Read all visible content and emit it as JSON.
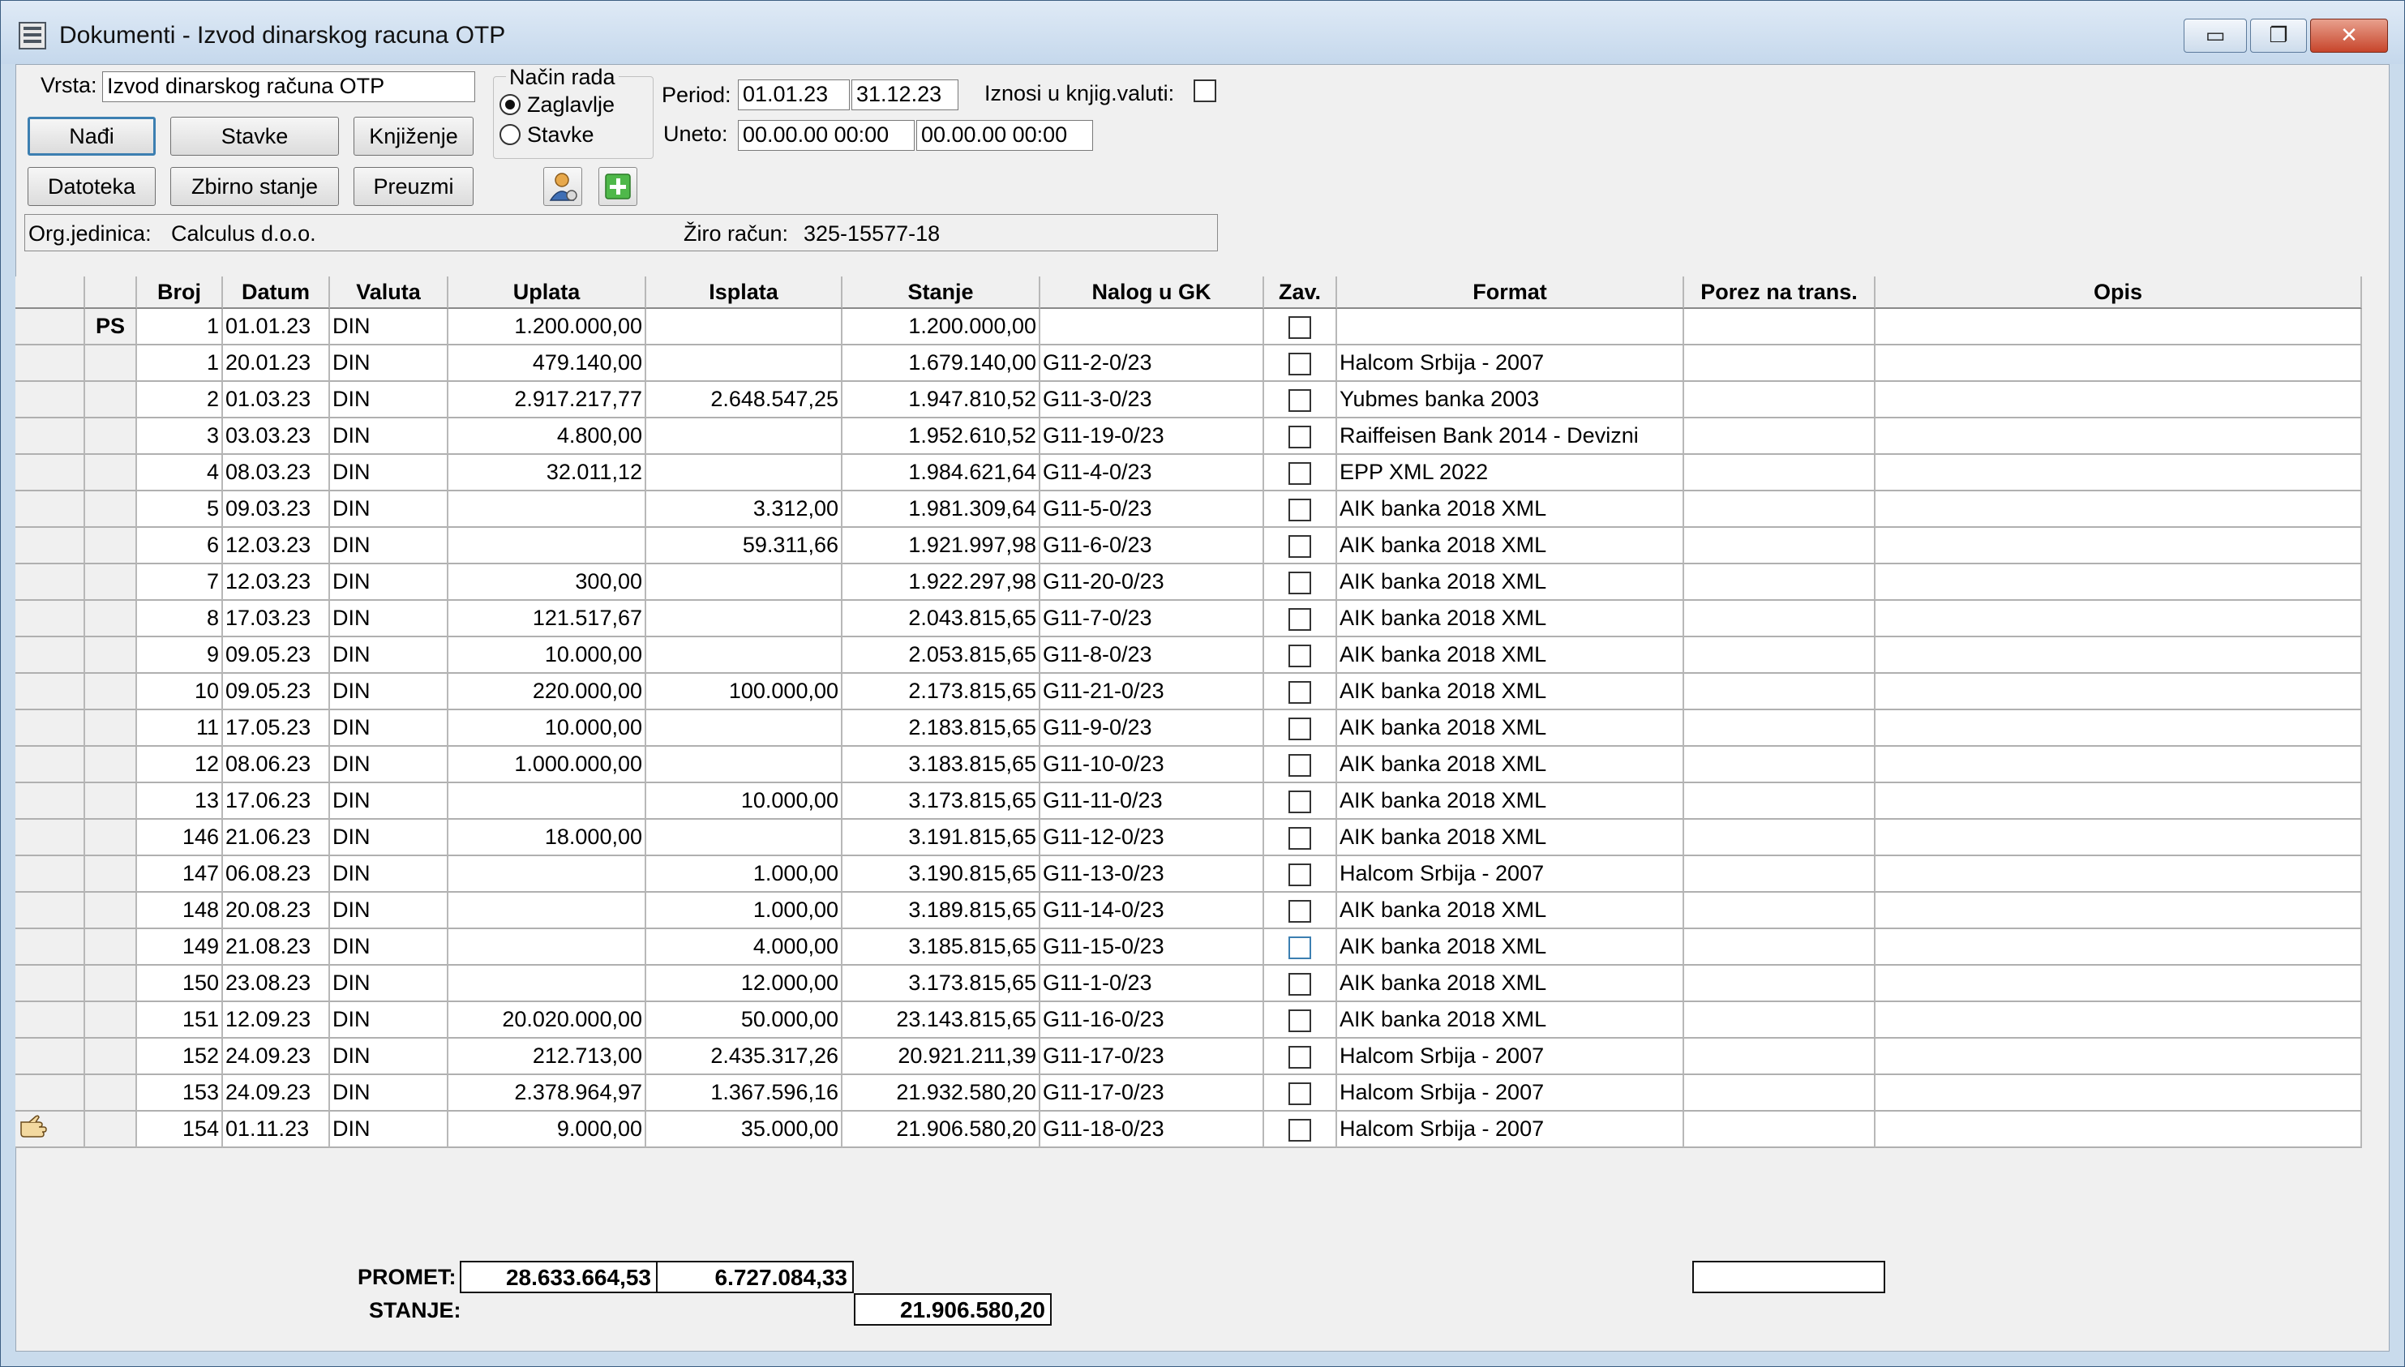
{
  "window": {
    "title": "Dokumenti - Izvod dinarskog racuna OTP",
    "controls": {
      "minimize": "▭",
      "maximize": "❐",
      "close": "✕"
    }
  },
  "header": {
    "vrsta_label": "Vrsta:",
    "vrsta_value": "Izvod dinarskog računa OTP",
    "nacin_rada_label": "Način rada",
    "radio_zaglavlje": "Zaglavlje",
    "radio_stavke": "Stavke",
    "period_label": "Period:",
    "period_from": "01.01.23",
    "period_to": "31.12.23",
    "iznosi_label": "Iznosi u knjig.valuti:",
    "uneto_label": "Uneto:",
    "uneto_from": "00.00.00 00:00",
    "uneto_to": "00.00.00 00:00"
  },
  "buttons": {
    "nadji": "Nađi",
    "stavke": "Stavke",
    "knjizenje": "Knjiženje",
    "datoteka": "Datoteka",
    "zbirno_stanje": "Zbirno stanje",
    "preuzmi": "Preuzmi"
  },
  "info": {
    "org_label": "Org.jedinica:",
    "org_value": "Calculus d.o.o.",
    "ziro_label": "Žiro račun:",
    "ziro_value": "325-15577-18"
  },
  "table": {
    "columns": [
      "Broj",
      "Datum",
      "Valuta",
      "Uplata",
      "Isplata",
      "Stanje",
      "Nalog u GK",
      "Zav.",
      "Format",
      "Porez na trans.",
      "Opis"
    ],
    "rows": [
      {
        "marker": "PS",
        "broj": "1",
        "datum": "01.01.23",
        "valuta": "DIN",
        "uplata": "1.200.000,00",
        "isplata": "",
        "stanje": "1.200.000,00",
        "nalog": "",
        "format": "",
        "porez": "",
        "opis": ""
      },
      {
        "marker": "",
        "broj": "1",
        "datum": "20.01.23",
        "valuta": "DIN",
        "uplata": "479.140,00",
        "isplata": "",
        "stanje": "1.679.140,00",
        "nalog": "G11-2-0/23",
        "format": "Halcom Srbija - 2007",
        "porez": "",
        "opis": ""
      },
      {
        "marker": "",
        "broj": "2",
        "datum": "01.03.23",
        "valuta": "DIN",
        "uplata": "2.917.217,77",
        "isplata": "2.648.547,25",
        "stanje": "1.947.810,52",
        "nalog": "G11-3-0/23",
        "format": "Yubmes banka 2003",
        "porez": "",
        "opis": ""
      },
      {
        "marker": "",
        "broj": "3",
        "datum": "03.03.23",
        "valuta": "DIN",
        "uplata": "4.800,00",
        "isplata": "",
        "stanje": "1.952.610,52",
        "nalog": "G11-19-0/23",
        "format": "Raiffeisen Bank 2014 - Devizni",
        "porez": "",
        "opis": ""
      },
      {
        "marker": "",
        "broj": "4",
        "datum": "08.03.23",
        "valuta": "DIN",
        "uplata": "32.011,12",
        "isplata": "",
        "stanje": "1.984.621,64",
        "nalog": "G11-4-0/23",
        "format": "EPP XML 2022",
        "porez": "",
        "opis": ""
      },
      {
        "marker": "",
        "broj": "5",
        "datum": "09.03.23",
        "valuta": "DIN",
        "uplata": "",
        "isplata": "3.312,00",
        "stanje": "1.981.309,64",
        "nalog": "G11-5-0/23",
        "format": "AIK banka 2018 XML",
        "porez": "",
        "opis": ""
      },
      {
        "marker": "",
        "broj": "6",
        "datum": "12.03.23",
        "valuta": "DIN",
        "uplata": "",
        "isplata": "59.311,66",
        "stanje": "1.921.997,98",
        "nalog": "G11-6-0/23",
        "format": "AIK banka 2018 XML",
        "porez": "",
        "opis": ""
      },
      {
        "marker": "",
        "broj": "7",
        "datum": "12.03.23",
        "valuta": "DIN",
        "uplata": "300,00",
        "isplata": "",
        "stanje": "1.922.297,98",
        "nalog": "G11-20-0/23",
        "format": "AIK banka 2018 XML",
        "porez": "",
        "opis": ""
      },
      {
        "marker": "",
        "broj": "8",
        "datum": "17.03.23",
        "valuta": "DIN",
        "uplata": "121.517,67",
        "isplata": "",
        "stanje": "2.043.815,65",
        "nalog": "G11-7-0/23",
        "format": "AIK banka 2018 XML",
        "porez": "",
        "opis": ""
      },
      {
        "marker": "",
        "broj": "9",
        "datum": "09.05.23",
        "valuta": "DIN",
        "uplata": "10.000,00",
        "isplata": "",
        "stanje": "2.053.815,65",
        "nalog": "G11-8-0/23",
        "format": "AIK banka 2018 XML",
        "porez": "",
        "opis": ""
      },
      {
        "marker": "",
        "broj": "10",
        "datum": "09.05.23",
        "valuta": "DIN",
        "uplata": "220.000,00",
        "isplata": "100.000,00",
        "stanje": "2.173.815,65",
        "nalog": "G11-21-0/23",
        "format": "AIK banka 2018 XML",
        "porez": "",
        "opis": ""
      },
      {
        "marker": "",
        "broj": "11",
        "datum": "17.05.23",
        "valuta": "DIN",
        "uplata": "10.000,00",
        "isplata": "",
        "stanje": "2.183.815,65",
        "nalog": "G11-9-0/23",
        "format": "AIK banka 2018 XML",
        "porez": "",
        "opis": ""
      },
      {
        "marker": "",
        "broj": "12",
        "datum": "08.06.23",
        "valuta": "DIN",
        "uplata": "1.000.000,00",
        "isplata": "",
        "stanje": "3.183.815,65",
        "nalog": "G11-10-0/23",
        "format": "AIK banka 2018 XML",
        "porez": "",
        "opis": ""
      },
      {
        "marker": "",
        "broj": "13",
        "datum": "17.06.23",
        "valuta": "DIN",
        "uplata": "",
        "isplata": "10.000,00",
        "stanje": "3.173.815,65",
        "nalog": "G11-11-0/23",
        "format": "AIK banka 2018 XML",
        "porez": "",
        "opis": ""
      },
      {
        "marker": "",
        "broj": "146",
        "datum": "21.06.23",
        "valuta": "DIN",
        "uplata": "18.000,00",
        "isplata": "",
        "stanje": "3.191.815,65",
        "nalog": "G11-12-0/23",
        "format": "AIK banka 2018 XML",
        "porez": "",
        "opis": ""
      },
      {
        "marker": "",
        "broj": "147",
        "datum": "06.08.23",
        "valuta": "DIN",
        "uplata": "",
        "isplata": "1.000,00",
        "stanje": "3.190.815,65",
        "nalog": "G11-13-0/23",
        "format": "Halcom Srbija - 2007",
        "porez": "",
        "opis": ""
      },
      {
        "marker": "",
        "broj": "148",
        "datum": "20.08.23",
        "valuta": "DIN",
        "uplata": "",
        "isplata": "1.000,00",
        "stanje": "3.189.815,65",
        "nalog": "G11-14-0/23",
        "format": "AIK banka 2018 XML",
        "porez": "",
        "opis": ""
      },
      {
        "marker": "",
        "broj": "149",
        "datum": "21.08.23",
        "valuta": "DIN",
        "uplata": "",
        "isplata": "4.000,00",
        "stanje": "3.185.815,65",
        "nalog": "G11-15-0/23",
        "format": "AIK banka 2018 XML",
        "porez": "",
        "opis": ""
      },
      {
        "marker": "",
        "broj": "150",
        "datum": "23.08.23",
        "valuta": "DIN",
        "uplata": "",
        "isplata": "12.000,00",
        "stanje": "3.173.815,65",
        "nalog": "G11-1-0/23",
        "format": "AIK banka 2018 XML",
        "porez": "",
        "opis": ""
      },
      {
        "marker": "",
        "broj": "151",
        "datum": "12.09.23",
        "valuta": "DIN",
        "uplata": "20.020.000,00",
        "isplata": "50.000,00",
        "stanje": "23.143.815,65",
        "nalog": "G11-16-0/23",
        "format": "AIK banka 2018 XML",
        "porez": "",
        "opis": ""
      },
      {
        "marker": "",
        "broj": "152",
        "datum": "24.09.23",
        "valuta": "DIN",
        "uplata": "212.713,00",
        "isplata": "2.435.317,26",
        "stanje": "20.921.211,39",
        "nalog": "G11-17-0/23",
        "format": "Halcom Srbija - 2007",
        "porez": "",
        "opis": ""
      },
      {
        "marker": "",
        "broj": "153",
        "datum": "24.09.23",
        "valuta": "DIN",
        "uplata": "2.378.964,97",
        "isplata": "1.367.596,16",
        "stanje": "21.932.580,20",
        "nalog": "G11-17-0/23",
        "format": "Halcom Srbija - 2007",
        "porez": "",
        "opis": ""
      },
      {
        "marker": "",
        "broj": "154",
        "datum": "01.11.23",
        "valuta": "DIN",
        "uplata": "9.000,00",
        "isplata": "35.000,00",
        "stanje": "21.906.580,20",
        "nalog": "G11-18-0/23",
        "format": "Halcom Srbija - 2007",
        "porez": "",
        "opis": ""
      }
    ]
  },
  "totals": {
    "promet_label": "PROMET:",
    "promet_uplata": "28.633.664,53",
    "promet_isplata": "6.727.084,33",
    "stanje_label": "STANJE:",
    "stanje_value": "21.906.580,20",
    "porez_total": ""
  }
}
